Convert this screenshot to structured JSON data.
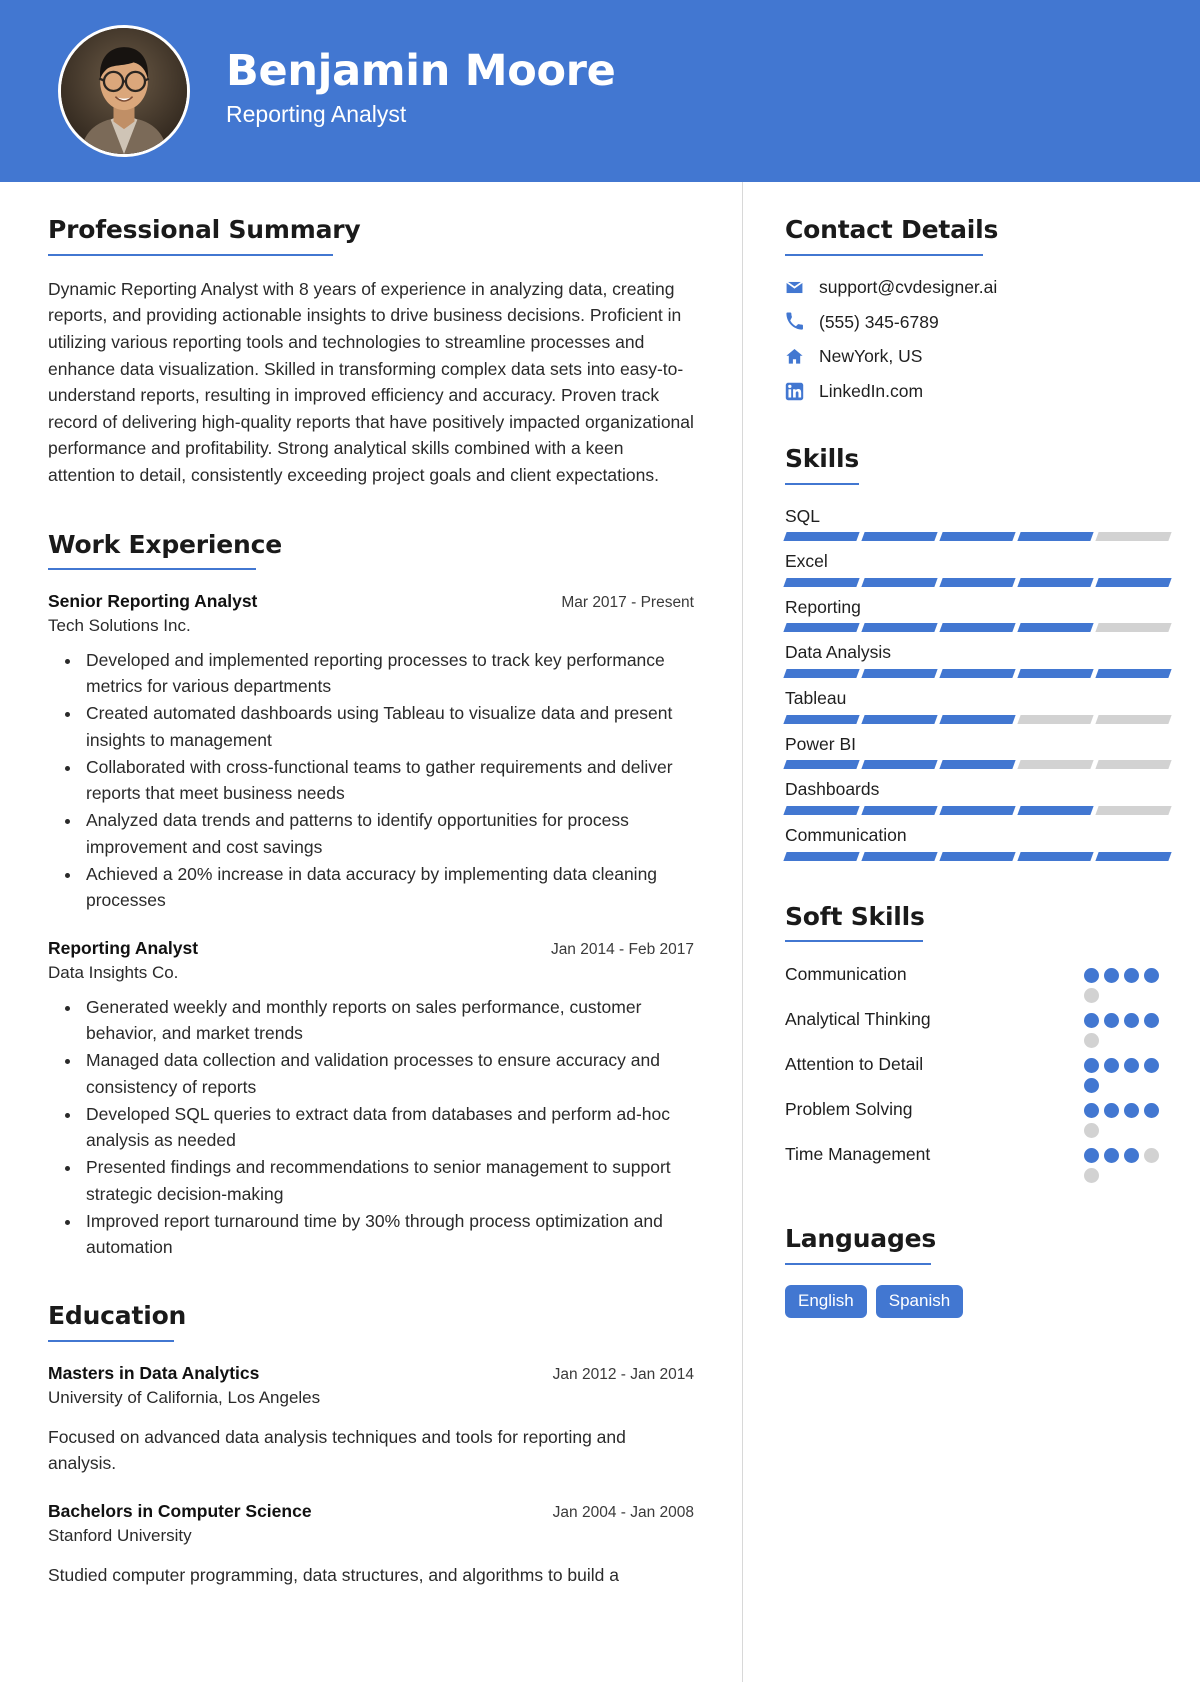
{
  "theme": {
    "accent": "#4277d1",
    "accent_light": "#d2d2d2",
    "header_bg": "#4277d1",
    "text": "#1a1a1a"
  },
  "header": {
    "name": "Benjamin Moore",
    "role": "Reporting Analyst",
    "avatar_icon": "person-photo"
  },
  "main": {
    "summary": {
      "heading": "Professional Summary",
      "text": "Dynamic Reporting Analyst with 8 years of experience in analyzing data, creating reports, and providing actionable insights to drive business decisions. Proficient in utilizing various reporting tools and technologies to streamline processes and enhance data visualization. Skilled in transforming complex data sets into easy-to-understand reports, resulting in improved efficiency and accuracy. Proven track record of delivering high-quality reports that have positively impacted organizational performance and profitability. Strong analytical skills combined with a keen attention to detail, consistently exceeding project goals and client expectations."
    },
    "work": {
      "heading": "Work Experience",
      "entries": [
        {
          "title": "Senior Reporting Analyst",
          "dates": "Mar 2017 - Present",
          "org": "Tech Solutions Inc.",
          "bullets": [
            "Developed and implemented reporting processes to track key performance metrics for various departments",
            "Created automated dashboards using Tableau to visualize data and present insights to management",
            "Collaborated with cross-functional teams to gather requirements and deliver reports that meet business needs",
            "Analyzed data trends and patterns to identify opportunities for process improvement and cost savings",
            "Achieved a 20% increase in data accuracy by implementing data cleaning processes"
          ]
        },
        {
          "title": "Reporting Analyst",
          "dates": "Jan 2014 - Feb 2017",
          "org": "Data Insights Co.",
          "bullets": [
            "Generated weekly and monthly reports on sales performance, customer behavior, and market trends",
            "Managed data collection and validation processes to ensure accuracy and consistency of reports",
            "Developed SQL queries to extract data from databases and perform ad-hoc analysis as needed",
            "Presented findings and recommendations to senior management to support strategic decision-making",
            "Improved report turnaround time by 30% through process optimization and automation"
          ]
        }
      ]
    },
    "education": {
      "heading": "Education",
      "entries": [
        {
          "title": "Masters in Data Analytics",
          "dates": "Jan 2012 - Jan 2014",
          "org": "University of California, Los Angeles",
          "desc": "Focused on advanced data analysis techniques and tools for reporting and analysis."
        },
        {
          "title": "Bachelors in Computer Science",
          "dates": "Jan 2004 - Jan 2008",
          "org": "Stanford University",
          "desc": "Studied computer programming, data structures, and algorithms to build a"
        }
      ]
    }
  },
  "sidebar": {
    "contact": {
      "heading": "Contact Details",
      "items": [
        {
          "icon": "envelope-icon",
          "value": "support@cvdesigner.ai"
        },
        {
          "icon": "phone-icon",
          "value": "(555) 345-6789"
        },
        {
          "icon": "home-icon",
          "value": "NewYork, US"
        },
        {
          "icon": "linkedin-icon",
          "value": "LinkedIn.com"
        }
      ]
    },
    "skills": {
      "heading": "Skills",
      "max": 5,
      "items": [
        {
          "name": "SQL",
          "level": 4
        },
        {
          "name": "Excel",
          "level": 5
        },
        {
          "name": "Reporting",
          "level": 4
        },
        {
          "name": "Data Analysis",
          "level": 5
        },
        {
          "name": "Tableau",
          "level": 3
        },
        {
          "name": "Power BI",
          "level": 3
        },
        {
          "name": "Dashboards",
          "level": 4
        },
        {
          "name": "Communication",
          "level": 5
        }
      ]
    },
    "soft_skills": {
      "heading": "Soft Skills",
      "max": 5,
      "items": [
        {
          "name": "Communication",
          "level": 4
        },
        {
          "name": "Analytical Thinking",
          "level": 4
        },
        {
          "name": "Attention to Detail",
          "level": 5
        },
        {
          "name": "Problem Solving",
          "level": 4
        },
        {
          "name": "Time Management",
          "level": 3
        }
      ]
    },
    "languages": {
      "heading": "Languages",
      "items": [
        "English",
        "Spanish"
      ]
    }
  }
}
